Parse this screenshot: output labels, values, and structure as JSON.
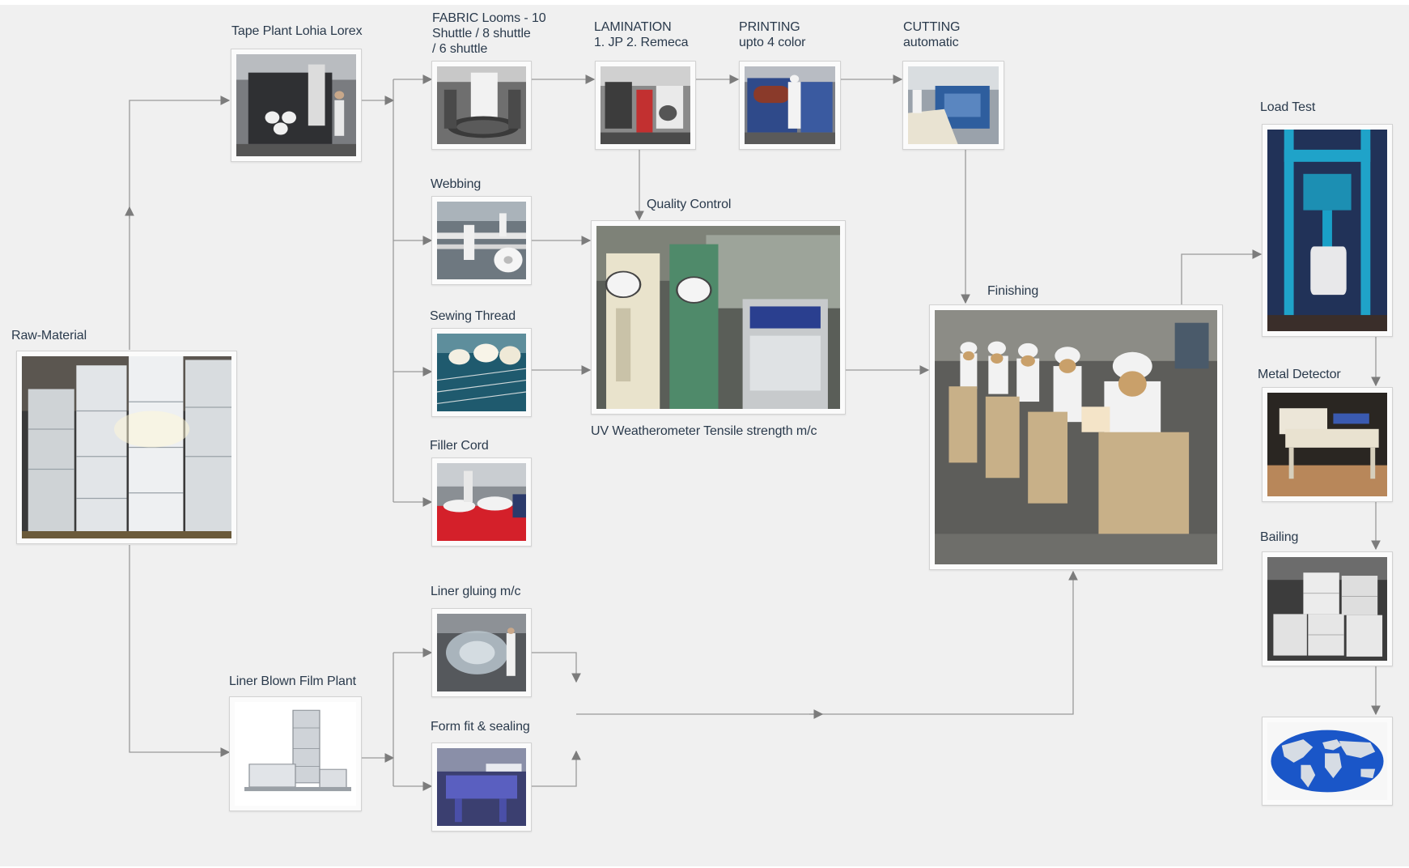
{
  "stages": {
    "raw_material": "Raw-Material",
    "tape_plant": "Tape Plant Lohia Lorex",
    "fabric_looms": [
      "FABRIC Looms - 10",
      "Shuttle / 8 shuttle",
      "/ 6 shuttle"
    ],
    "lamination": [
      "LAMINATION",
      "1. JP 2. Remeca"
    ],
    "printing": [
      "PRINTING",
      "upto 4 color"
    ],
    "cutting": [
      "CUTTING",
      "automatic"
    ],
    "webbing": "Webbing",
    "sewing_thread": "Sewing Thread",
    "filler_cord": "Filler Cord",
    "quality_control": "Quality Control",
    "uv_caption": "UV Weatherometer Tensile strength m/c",
    "finishing": "Finishing",
    "liner_gluing": "Liner gluing m/c",
    "form_fit": "Form fit & sealing",
    "liner_blown": "Liner Blown Film Plant",
    "load_test": "Load Test",
    "metal_detector": "Metal Detector",
    "bailing": "Bailing"
  },
  "colors": {
    "background": "#f0f0f0",
    "connector": "#9a9a9a",
    "label": "#2a3a4c"
  }
}
